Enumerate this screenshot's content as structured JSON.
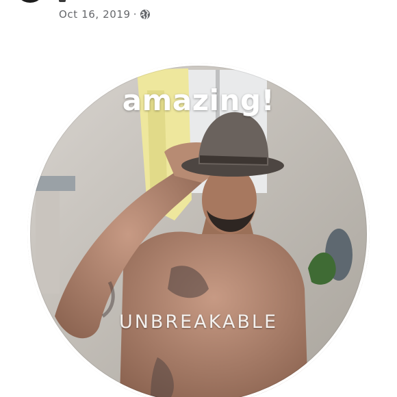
{
  "post": {
    "date": "Oct 16, 2019",
    "separator": "·",
    "audience_icon": "globe-icon"
  },
  "frame": {
    "caption_top": "amazing!",
    "caption_bottom": "UNBREAKABLE"
  },
  "colors": {
    "meta_text": "#65676b",
    "caption": "#ffffff",
    "frame_border": "#ffffff"
  }
}
